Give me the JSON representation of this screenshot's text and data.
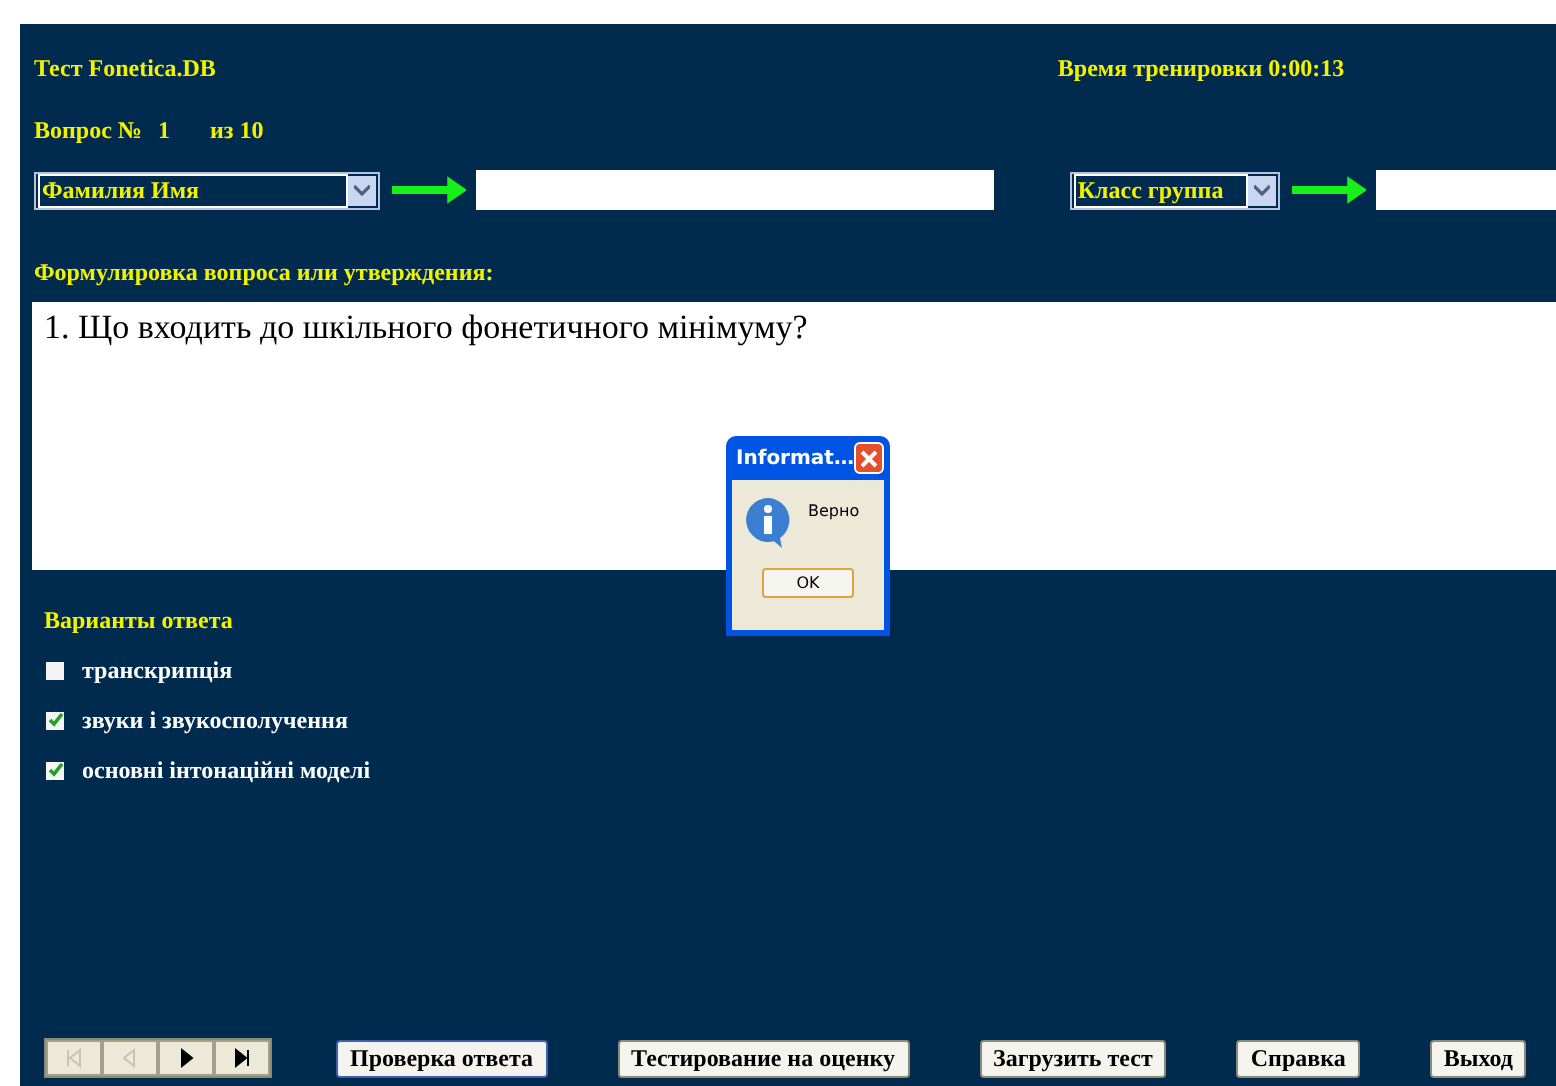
{
  "title": "Тест Fonetica.DB",
  "timer": "Время тренировки 0:00:13",
  "question_number": {
    "label": "Вопрос №",
    "number": "1",
    "total": "из 10"
  },
  "name_select": {
    "value": "Фамилия Имя"
  },
  "class_select": {
    "value": "Класс группа"
  },
  "question_label": "Формулировка вопроса или утверждения:",
  "question_text": "1. Що входить до шкільного фонетичного мінімуму?",
  "answers_label": "Варианты ответа",
  "answers": [
    {
      "label": "транскрипція",
      "checked": false
    },
    {
      "label": "звуки і звукосполучення",
      "checked": true
    },
    {
      "label": "основні інтонаційні моделі",
      "checked": true
    }
  ],
  "nav_buttons": [
    {
      "kind": "first",
      "disabled": true
    },
    {
      "kind": "prev",
      "disabled": true
    },
    {
      "kind": "next",
      "disabled": false
    },
    {
      "kind": "last",
      "disabled": false
    }
  ],
  "buttons": [
    "Проверка ответа",
    "Тестирование на оценку",
    "Загрузить тест",
    "Справка",
    "Выход"
  ],
  "dialog": {
    "title": "Informat…",
    "message": "Верно",
    "button": "OK"
  }
}
